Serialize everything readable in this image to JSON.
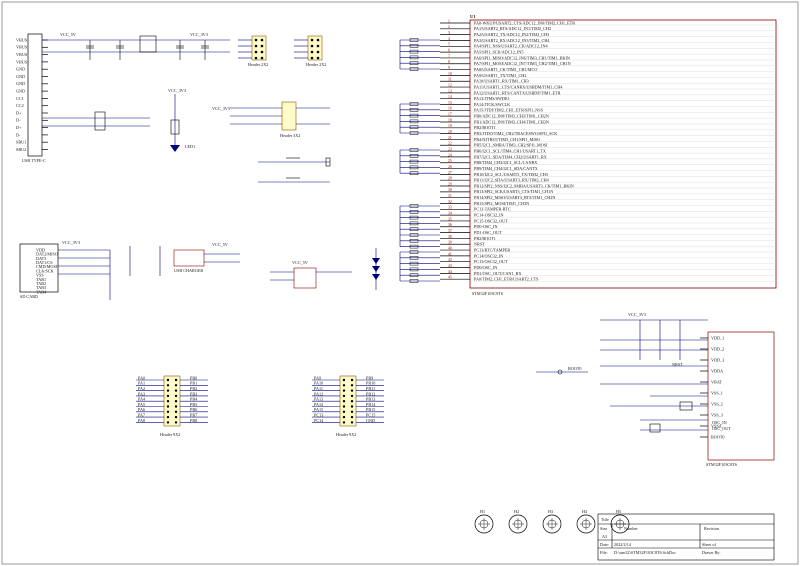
{
  "sheet": {
    "u_mcu_label": "U1",
    "u_mcu_part": "STM32F103C8T6",
    "title_label": "Title",
    "size_label": "Size",
    "size_value": "A3",
    "number_label": "Number",
    "revision_label": "Revision",
    "date_label": "Date:",
    "date_value": "2022/2/14",
    "file_label": "File:",
    "file_value": "D:\\stm32\\STM32F103C8T6.SchDoc",
    "sheet_label": "Sheet of",
    "drawn_label": "Drawn By:"
  },
  "labels": {
    "usb_conn": "USB TYPE-C",
    "sd_card": "SD CARD",
    "header_2x2_a": "Header 2X2",
    "header_2x2_b": "Header 2X2",
    "header_3x2": "Header 3X2",
    "header_9x2_a": "Header 9X2",
    "header_9x2_b": "Header 9X2",
    "usb_charger": "USB CHARGER",
    "mcu_footer": "STM32F103C8T6",
    "boot0": "BOOT0",
    "vcc_3v3": "VCC_3V3",
    "vcc_5v": "VCC_5V",
    "gnd": "GND",
    "led1": "LED1",
    "nrst": "NRST",
    "osc_in": "OSC_IN",
    "osc_out": "OSC_OUT",
    "xtal": "8MHz",
    "xtal32": "32.768KHz"
  },
  "usb_pins": [
    "VBUS",
    "VBUS",
    "VBUS",
    "VBUS",
    "GND",
    "GND",
    "GND",
    "GND",
    "CC1",
    "CC2",
    "D+",
    "D-",
    "D+",
    "D-",
    "SBU1",
    "SBU2"
  ],
  "sd_pins": [
    "VDD",
    "DAT2/MISO",
    "DAT3",
    "DAT1/CS",
    "CMD/MOSI",
    "CLK/SCK",
    "VSS",
    "TAB1",
    "TAB2",
    "TAB3",
    "TAB4"
  ],
  "mcu_rows": [
    "PA0-WKUP/USART2_CTS/ADC12_IN0/TIM2_CH1_ETR",
    "PA1/USART2_RTS/ADC12_IN1/TIM2_CH2",
    "PA2/USART2_TX/ADC12_IN2/TIM2_CH3",
    "PA3/USART2_RX/ADC12_IN3/TIM2_CH4",
    "PA4/SPI1_NSS/USART2_CK/ADC12_IN4",
    "PA5/SPI1_SCK/ADC12_IN5",
    "PA6/SPI1_MISO/ADC12_IN6/TIM3_CH1/TIM1_BKIN",
    "PA7/SPI1_MOSI/ADC12_IN7/TIM3_CH2/TIM1_CH1N",
    "PA8/USART1_CK/TIM1_CH1/MCO",
    "PA9/USART1_TX/TIM1_CH2",
    "PA10/USART1_RX/TIM1_CH3",
    "PA11/USART1_CTS/CANRX/USBDM/TIM1_CH4",
    "PA12/USART1_RTS/CANTX/USBDP/TIM1_ETR",
    "PA13/JTMS/SWDIO",
    "PA14/JTCK/SWCLK",
    "PA15/JTDI/TIM2_CH1_ETR/SPI1_NSS",
    "PB0/ADC12_IN8/TIM3_CH3/TIM1_CH2N",
    "PB1/ADC12_IN9/TIM3_CH4/TIM1_CH3N",
    "PB2/BOOT1",
    "PB3/JTDO/TIM2_CH2/TRACESWO/SPI1_SCK",
    "PB4/NJTRST/TIM3_CH1/SPI1_MISO",
    "PB5/I2C1_SMBA/TIM3_CH2/SPI1_MOSI",
    "PB6/I2C1_SCL/TIM4_CH1/USART1_TX",
    "PB7/I2C1_SDA/TIM4_CH2/USART1_RX",
    "PB8/TIM4_CH3/I2C1_SCL/CANRX",
    "PB9/TIM4_CH4/I2C1_SDA/CANTX",
    "PB10/I2C2_SCL/USART3_TX/TIM2_CH3",
    "PB11/I2C2_SDA/USART3_RX/TIM2_CH4",
    "PB12/SPI2_NSS/I2C2_SMBA/USART3_CK/TIM1_BKIN",
    "PB13/SPI2_SCK/USART3_CTS/TIM1_CH1N",
    "PB14/SPI2_MISO/USART3_RTS/TIM1_CH2N",
    "PB15/SPI2_MOSI/TIM1_CH3N",
    "PC13-TAMPER-RTC",
    "PC14-OSC32_IN",
    "PC15-OSC32_OUT",
    "PD0-OSC_IN",
    "PD1-OSC_OUT",
    "PB2/BOOT1",
    "NRST",
    "PC13/RTC/TAMPER",
    "PC14/OSC32_IN",
    "PC15/OSC32_OUT",
    "PD0/OSC_IN",
    "PD1/OSC_OUT/CAN1_RX",
    "PA0/TIM2_CH1_ETR/USART2_CTS"
  ],
  "power_pins": [
    "VDD_1",
    "VDD_2",
    "VDD_3",
    "VDDA",
    "VBAT",
    "VSS_1",
    "VSS_2",
    "VSS_3",
    "VSSA",
    "BOOT0"
  ],
  "header_a_left": [
    "PA0",
    "PA1",
    "PA2",
    "PA3",
    "PA4",
    "PA5",
    "PA6",
    "PA7",
    "PA8"
  ],
  "header_a_right": [
    "PB0",
    "PB1",
    "PB2",
    "PB3",
    "PB4",
    "PB5",
    "PB6",
    "PB7",
    "PB8"
  ],
  "header_b_left": [
    "PA9",
    "PA10",
    "PA11",
    "PA12",
    "PA13",
    "PA14",
    "PA15",
    "PC13",
    "PC14"
  ],
  "header_b_right": [
    "PB9",
    "PB10",
    "PB11",
    "PB12",
    "PB13",
    "PB14",
    "PB15",
    "PC15",
    "GND"
  ],
  "mounting_holes": [
    "H1",
    "H2",
    "H3",
    "H4",
    "H5"
  ]
}
